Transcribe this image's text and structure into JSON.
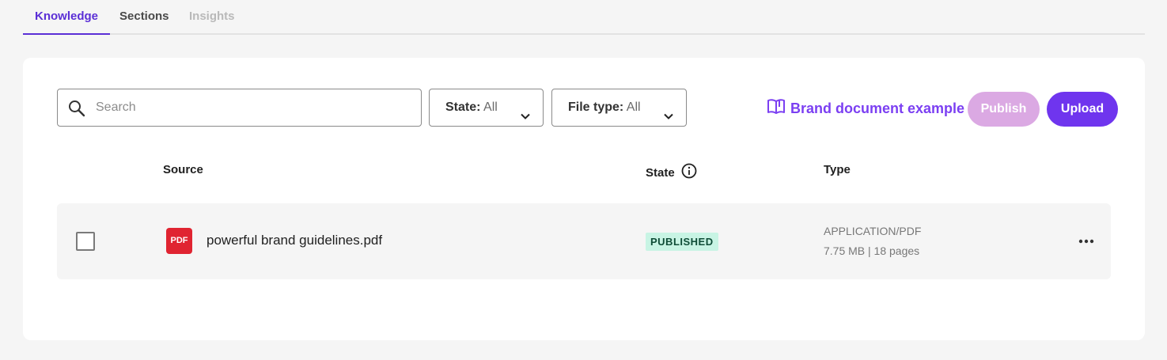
{
  "tabs": [
    {
      "label": "Knowledge",
      "active": true
    },
    {
      "label": "Sections",
      "active": false
    },
    {
      "label": "Insights",
      "active": false
    }
  ],
  "search": {
    "placeholder": "Search",
    "icon": "search-icon"
  },
  "filters": {
    "state": {
      "label": "State:",
      "value": "All"
    },
    "file_type": {
      "label": "File type:",
      "value": "All"
    }
  },
  "brand_link": {
    "label": "Brand document example",
    "icon": "book-icon"
  },
  "buttons": {
    "publish": "Publish",
    "upload": "Upload"
  },
  "table": {
    "headers": {
      "source": "Source",
      "state": "State",
      "type": "Type"
    },
    "rows": [
      {
        "file_icon": "PDF",
        "name": "powerful brand guidelines.pdf",
        "state": "PUBLISHED",
        "mime": "APPLICATION/PDF",
        "meta": "7.75 MB | 18 pages"
      }
    ]
  },
  "colors": {
    "accent": "#6f35ee",
    "active_tab": "#5b2fd6",
    "publish_disabled": "#dba9e3",
    "published_badge_bg": "#c8f4e4",
    "pdf_red": "#e02431"
  }
}
